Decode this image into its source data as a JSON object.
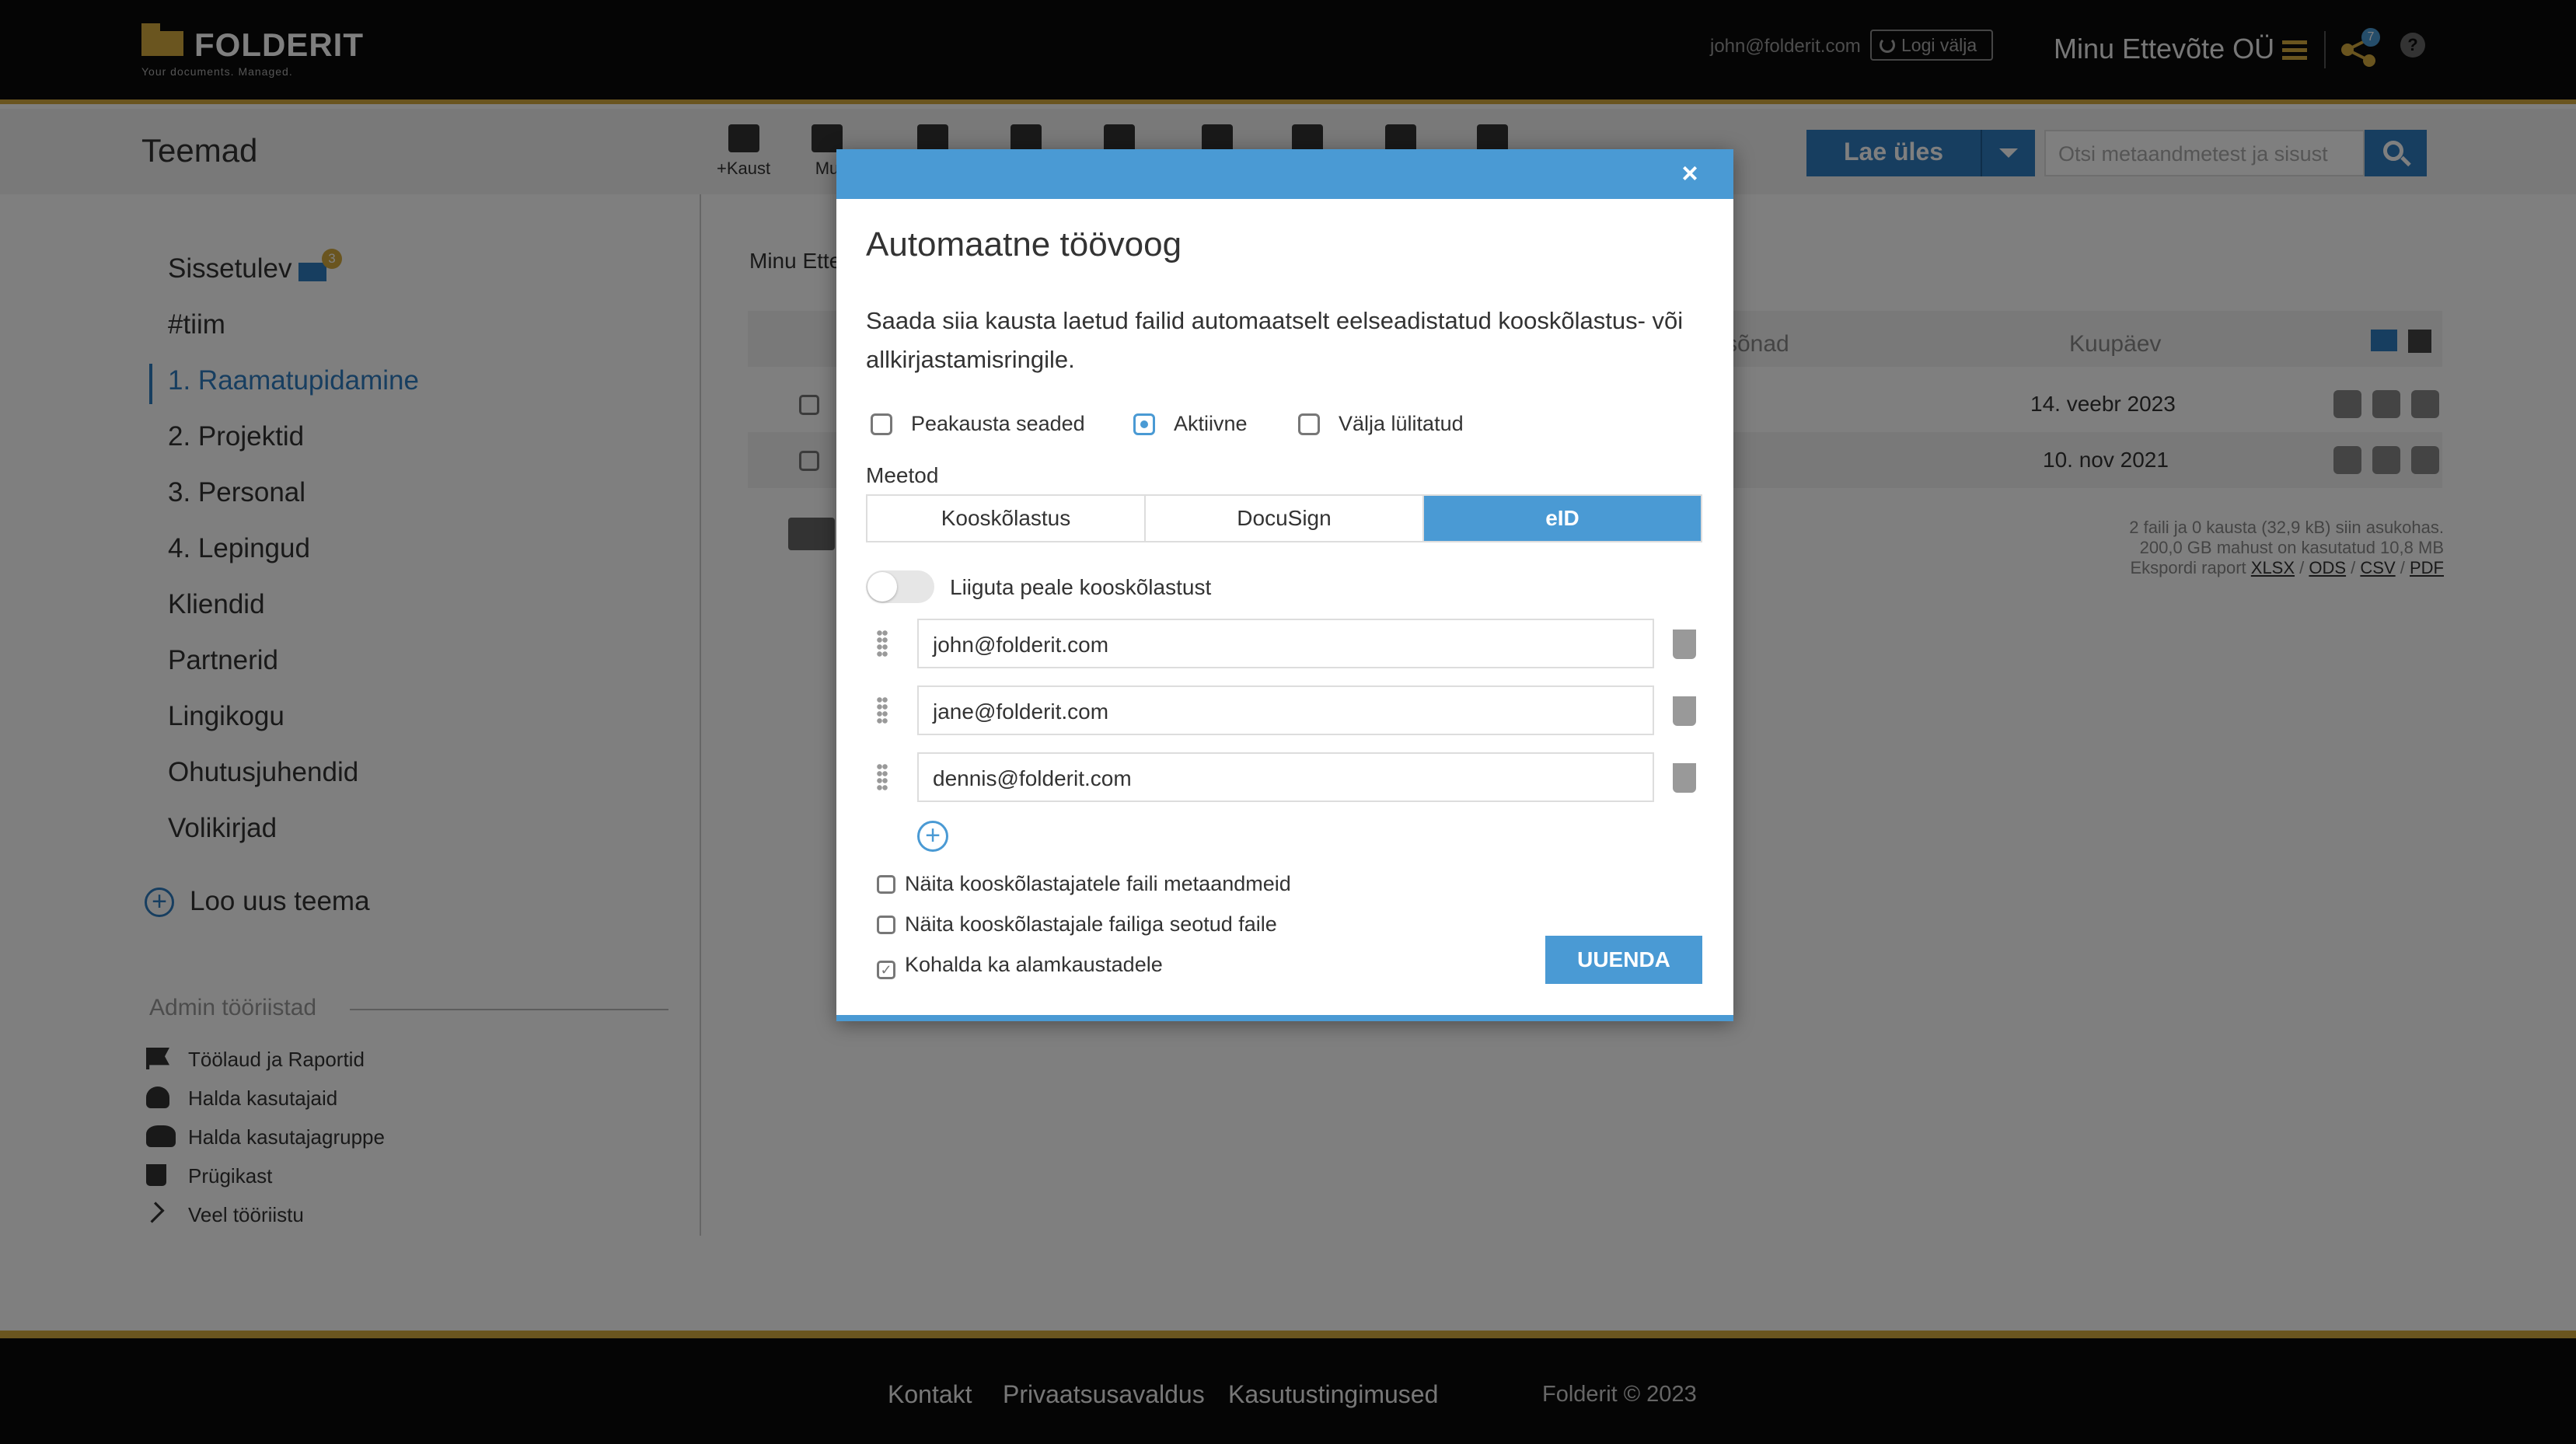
{
  "header": {
    "brand": "FOLDERIT",
    "tagline": "Your documents. Managed.",
    "user_email": "john@folderit.com",
    "logout_label": "Logi välja",
    "company": "Minu Ettevõte OÜ",
    "share_count": "7",
    "help_label": "?"
  },
  "toolbar": {
    "page_title": "Teemad",
    "add_folder_label": "+Kaust",
    "more_label": "Mu",
    "upload_label": "Lae üles",
    "search_placeholder": "Otsi metaandmetest ja sisust"
  },
  "sidebar": {
    "inbox_count": "3",
    "themes": [
      {
        "label": "Sissetulev"
      },
      {
        "label": "#tiim"
      },
      {
        "label": "1. Raamatupidamine"
      },
      {
        "label": "2. Projektid"
      },
      {
        "label": "3. Personal"
      },
      {
        "label": "4. Lepingud"
      },
      {
        "label": "Kliendid"
      },
      {
        "label": "Partnerid"
      },
      {
        "label": "Lingikogu"
      },
      {
        "label": "Ohutusjuhendid"
      },
      {
        "label": "Volikirjad"
      }
    ],
    "new_theme_label": "Loo uus teema",
    "admin_title": "Admin tööriistad",
    "admin_items": [
      {
        "label": "Töölaud ja Raportid",
        "icon": "flag-icon"
      },
      {
        "label": "Halda kasutajaid",
        "icon": "user-icon"
      },
      {
        "label": "Halda kasutajagruppe",
        "icon": "users-icon"
      },
      {
        "label": "Prügikast",
        "icon": "trash-icon"
      },
      {
        "label": "Veel tööriistu",
        "icon": "chevron-right-icon"
      }
    ]
  },
  "main": {
    "breadcrumb": "Minu Ette",
    "columns": {
      "keywords": "sõnad",
      "date": "Kuupäev"
    },
    "rows": [
      {
        "date": "14. veebr 2023"
      },
      {
        "date": "10. nov 2021"
      }
    ],
    "stats": {
      "line1": "2 faili ja 0 kausta (32,9 kB) siin asukohas.",
      "line2": "200,0 GB mahust on kasutatud 10,8 MB",
      "export_label": "Ekspordi raport",
      "formats": [
        "XLSX",
        "ODS",
        "CSV",
        "PDF"
      ]
    }
  },
  "modal": {
    "close_label": "×",
    "title": "Automaatne töövoog",
    "description": "Saada siia kausta laetud failid automaatselt eelseadistatud kooskõlastus- või allkirjastamisringile.",
    "modes": [
      {
        "label": "Peakausta seaded"
      },
      {
        "label": "Aktiivne"
      },
      {
        "label": "Välja lülitatud"
      }
    ],
    "method_label": "Meetod",
    "methods": [
      {
        "label": "Kooskõlastus"
      },
      {
        "label": "DocuSign"
      },
      {
        "label": "eID"
      }
    ],
    "toggle_label": "Liiguta peale kooskõlastust",
    "signers": [
      {
        "email": "john@folderit.com"
      },
      {
        "email": "jane@folderit.com"
      },
      {
        "email": "dennis@folderit.com"
      }
    ],
    "add_label": "+",
    "options": [
      {
        "label": "Näita kooskõlastajatele faili metaandmeid"
      },
      {
        "label": "Näita kooskõlastajale failiga seotud faile"
      },
      {
        "label": "Kohalda ka alamkaustadele"
      }
    ],
    "update_label": "UUENDA"
  },
  "footer": {
    "links": [
      "Kontakt",
      "Privaatsusavaldus",
      "Kasutustingimused"
    ],
    "copyright": "Folderit © 2023"
  },
  "colors": {
    "accent": "#4a9ad4",
    "brand_gold": "#d4aa3f",
    "dark": "#0b0b0b"
  }
}
